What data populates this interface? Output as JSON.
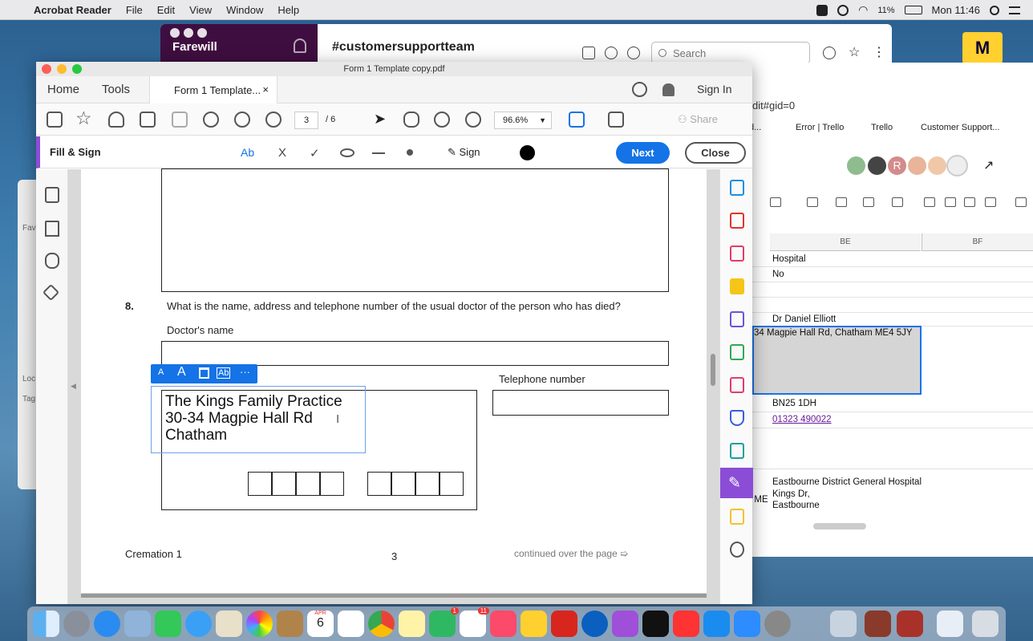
{
  "menubar": {
    "app_name": "Acrobat Reader",
    "items": [
      "File",
      "Edit",
      "View",
      "Window",
      "Help"
    ],
    "battery": "11%",
    "clock": "Mon 11:46"
  },
  "slack": {
    "workspace": "Farewill",
    "channel": "#customersupportteam",
    "search_placeholder": "Search"
  },
  "sheets": {
    "url": "dit#gid=0",
    "bookmarks": [
      "d...",
      "Error | Trello",
      "Trello",
      "Customer Support..."
    ],
    "avatar_letter": "R",
    "columns": [
      "BE",
      "BF"
    ],
    "cells": {
      "r1": "Hospital",
      "r2": "No",
      "r3": "Dr Daniel Elliott",
      "selected": "34 Magpie Hall Rd, Chatham ME4 5JY",
      "r5": "BN25 1DH",
      "r6": "01323 490022",
      "r7_line1": "Eastbourne District General Hospital",
      "r7_line2": "Kings Dr,",
      "r7_line3": "Eastbourne",
      "r7_left": "t ME"
    }
  },
  "finder": {
    "labels": [
      "Fav",
      "Loc",
      "Tag"
    ]
  },
  "acrobat": {
    "window_title": "Form 1 Template copy.pdf",
    "tabs": {
      "home": "Home",
      "tools": "Tools",
      "document": "Form 1 Template...",
      "sign_in": "Sign In"
    },
    "toolbar": {
      "page_current": "3",
      "page_total": "/ 6",
      "zoom": "96.6%",
      "share": "Share"
    },
    "fill_sign": {
      "title": "Fill & Sign",
      "text_tool": "Ab",
      "cross": "X",
      "check": "✓",
      "sign": "Sign",
      "next": "Next",
      "close": "Close"
    },
    "form": {
      "q_number": "8.",
      "question": "What is the name, address and telephone number of the usual doctor of the person who has died?",
      "doctor_label": "Doctor's name",
      "telephone_label": "Telephone number",
      "entry_lines": [
        "The Kings Family Practice",
        "30-34 Magpie Hall Rd",
        "Chatham"
      ],
      "footer_left": "Cremation 1",
      "footer_page": "3",
      "footer_right": "continued over the page ➯"
    },
    "floatbar": {
      "small_a": "A",
      "large_a": "A",
      "ab": "Ab",
      "more": "···"
    }
  },
  "dock": {
    "calendar_month": "APR",
    "calendar_day": "6",
    "badges": [
      "1",
      "11"
    ]
  }
}
